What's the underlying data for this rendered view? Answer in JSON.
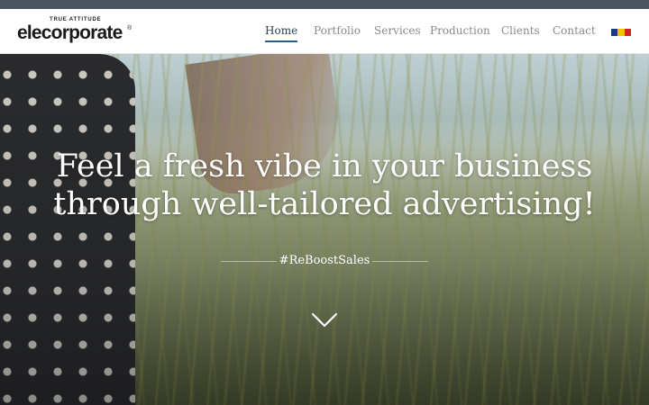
{
  "brand": {
    "tagline": "TRUE ATTITUDE",
    "name": "elecorporate",
    "reg": "®"
  },
  "nav": {
    "items": [
      {
        "label": "Home",
        "active": true
      },
      {
        "label": "Portfolio",
        "active": false
      },
      {
        "label": "Services",
        "active": false
      },
      {
        "label": "Production",
        "active": false
      },
      {
        "label": "Clients",
        "active": false
      },
      {
        "label": "Contact",
        "active": false
      }
    ],
    "flag_colors": [
      "#1b3a8a",
      "#f2c200",
      "#d2232a"
    ]
  },
  "hero": {
    "headline_line1": "Feel a fresh vibe in your business",
    "headline_line2": "through well-tailored advertising!",
    "hashtag": "#ReBoostSales",
    "scroll_icon": "chevron-down-icon"
  },
  "colors": {
    "topbar": "#4b5360",
    "nav_active": "#2c3e4f",
    "nav_underline": "#2a5d8a",
    "nav_text": "#8a8a8a"
  }
}
